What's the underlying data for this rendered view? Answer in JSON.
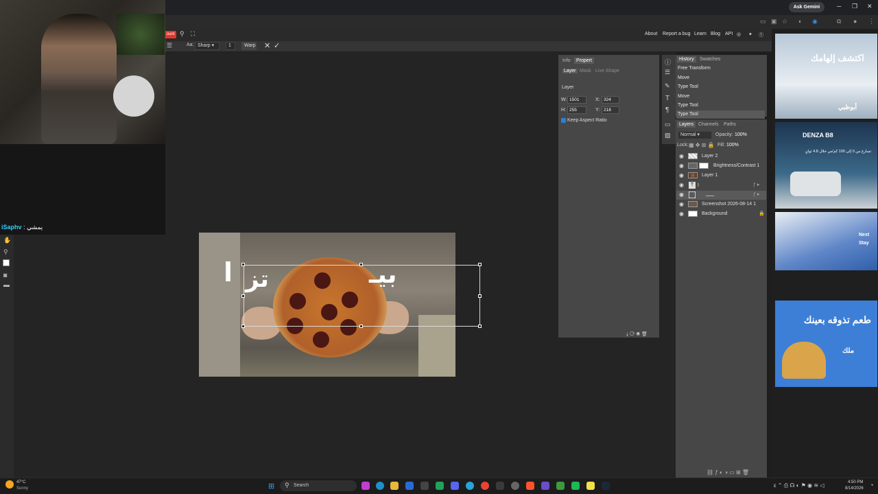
{
  "browser": {
    "gemini_label": "Ask Gemini",
    "controls": {
      "minimize": "─",
      "restore": "❐",
      "close": "✕"
    }
  },
  "site_nav": [
    "About",
    "Report a bug",
    "Learn",
    "Blog",
    "API"
  ],
  "options_bar": {
    "account_label": "ount",
    "aa_label": "Aa:",
    "antialias": "Sharp",
    "size": "1",
    "warp_label": "Warp"
  },
  "chat": {
    "user": "iSaphv",
    "message": ": يمشي"
  },
  "canvas": {
    "overlay_text_left": "ا",
    "overlay_text_mid": "تز",
    "overlay_text_right": "بيـ"
  },
  "properties": {
    "tabs": [
      "Info",
      "Propert"
    ],
    "subtabs": [
      "Layer",
      "Mask",
      "Live Shape"
    ],
    "section": "Layer",
    "w_label": "W:",
    "w": "1501",
    "h_label": "H:",
    "h": "255",
    "x_label": "X:",
    "x": "324",
    "y_label": "Y:",
    "y": "218",
    "keep_ratio": "Keep Aspect Ratio"
  },
  "history": {
    "tabs": [
      "History",
      "Swatches"
    ],
    "items": [
      "Free Transform",
      "Move",
      "Type Tool",
      "Move",
      "Type Tool",
      "Type Tool"
    ]
  },
  "layers": {
    "tabs": [
      "Layers",
      "Channels",
      "Paths"
    ],
    "blend": "Normal",
    "opacity_label": "Opacity:",
    "opacity": "100%",
    "lock_label": "Lock:",
    "fill_label": "Fill:",
    "fill": "100%",
    "items": [
      {
        "name": "Layer 2"
      },
      {
        "name": "Brightness/Contrast 1"
      },
      {
        "name": "Layer 1"
      },
      {
        "name": "ا"
      },
      {
        "name": "ــــــ"
      },
      {
        "name": "Screenshot 2026-08-14 1"
      },
      {
        "name": "Background"
      }
    ]
  },
  "ads": {
    "ad1_title": "اكتشف إلهامك",
    "ad1_brand": "أبوظبي",
    "ad2_brand": "DENZA B8",
    "ad2_text": "تسارع من 0 إلى 100 كم/س خلال 4.8 ثوانٍ",
    "ad3_next": "Next",
    "ad3_stay": "Stay",
    "ad4_title": "طعم تذوقه بعينك",
    "ad4_sub": "ملك"
  },
  "taskbar": {
    "weather_temp": "47°C",
    "weather_desc": "Sunny",
    "search": "Search",
    "time": "4:50 PM",
    "date": "8/14/2026"
  },
  "colors": {
    "accent_red": "#e0362c",
    "panel": "#474747",
    "workspace": "#242424"
  }
}
